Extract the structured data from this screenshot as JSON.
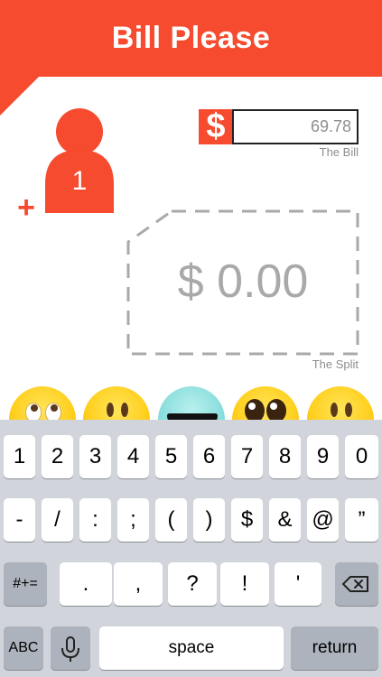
{
  "header": {
    "title": "Bill Please"
  },
  "person": {
    "count": "1",
    "add_label": "+"
  },
  "bill": {
    "currency_symbol": "$",
    "value": "69.78",
    "caption": "The Bill"
  },
  "split": {
    "value": "$ 0.00",
    "caption": "The Split"
  },
  "emojis": [
    "eye-roll-emoji",
    "neutral-emoji",
    "sunglasses-emoji",
    "wide-eyes-emoji",
    "neutral-emoji"
  ],
  "keyboard": {
    "row1": [
      "1",
      "2",
      "3",
      "4",
      "5",
      "6",
      "7",
      "8",
      "9",
      "0"
    ],
    "row2": [
      "-",
      "/",
      ":",
      ";",
      "(",
      ")",
      "$",
      "&",
      "@",
      "”"
    ],
    "row3": [
      ".",
      ",",
      "?",
      "!",
      "'"
    ],
    "symbols_label": "#+=",
    "abc_label": "ABC",
    "space_label": "space",
    "return_label": "return"
  },
  "colors": {
    "accent": "#f64b2e",
    "keyboard_bg": "#d1d5db",
    "muted_text": "#8e8e8e"
  }
}
